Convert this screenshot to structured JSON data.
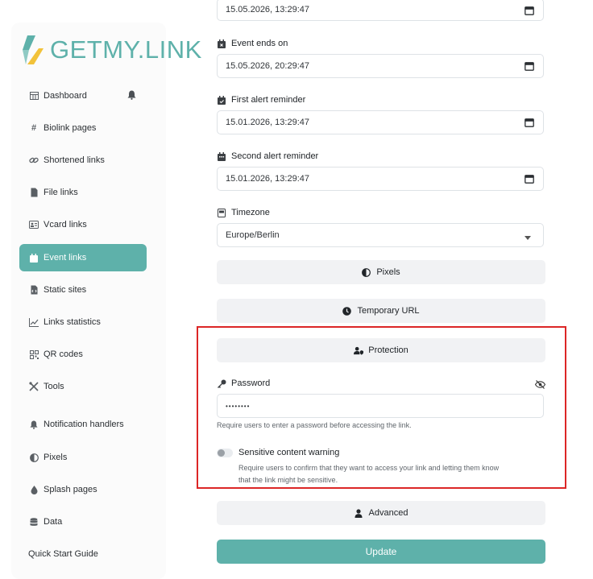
{
  "brand": {
    "logo_text": "GETMY.LINK",
    "accent": "#5eb1aa"
  },
  "sidebar": {
    "items": [
      {
        "label": "Dashboard",
        "icon": "table-icon"
      },
      {
        "label": "Biolink pages",
        "icon": "hash-icon"
      },
      {
        "label": "Shortened links",
        "icon": "link-icon"
      },
      {
        "label": "File links",
        "icon": "file-icon"
      },
      {
        "label": "Vcard links",
        "icon": "id-card-icon"
      },
      {
        "label": "Event links",
        "icon": "calendar-icon",
        "active": true
      },
      {
        "label": "Static sites",
        "icon": "file-code-icon"
      },
      {
        "label": "Links statistics",
        "icon": "chart-icon"
      },
      {
        "label": "QR codes",
        "icon": "qr-icon"
      },
      {
        "label": "Tools",
        "icon": "tools-icon"
      },
      {
        "label": "Notification handlers",
        "icon": "bell-icon"
      },
      {
        "label": "Pixels",
        "icon": "adjust-icon"
      },
      {
        "label": "Splash pages",
        "icon": "droplet-icon"
      },
      {
        "label": "Data",
        "icon": "database-icon"
      }
    ],
    "quick_start": "Quick Start Guide"
  },
  "form": {
    "event_start_value": "15.05.2026, 13:29:47",
    "event_ends_label": "Event ends on",
    "event_ends_value": "15.05.2026, 20:29:47",
    "first_alert_label": "First alert reminder",
    "first_alert_value": "15.01.2026, 13:29:47",
    "second_alert_label": "Second alert reminder",
    "second_alert_value": "15.01.2026, 13:29:47",
    "timezone_label": "Timezone",
    "timezone_value": "Europe/Berlin",
    "pixels_label": "Pixels",
    "temporary_url_label": "Temporary URL",
    "protection_label": "Protection",
    "password_label": "Password",
    "password_value": "••••••••",
    "password_help": "Require users to enter a password before accessing the link.",
    "sensitive_label": "Sensitive content warning",
    "sensitive_help_1": "Require users to confirm that they want to access your link and letting them know",
    "sensitive_help_2": "that the link might be sensitive.",
    "advanced_label": "Advanced",
    "update_label": "Update"
  }
}
